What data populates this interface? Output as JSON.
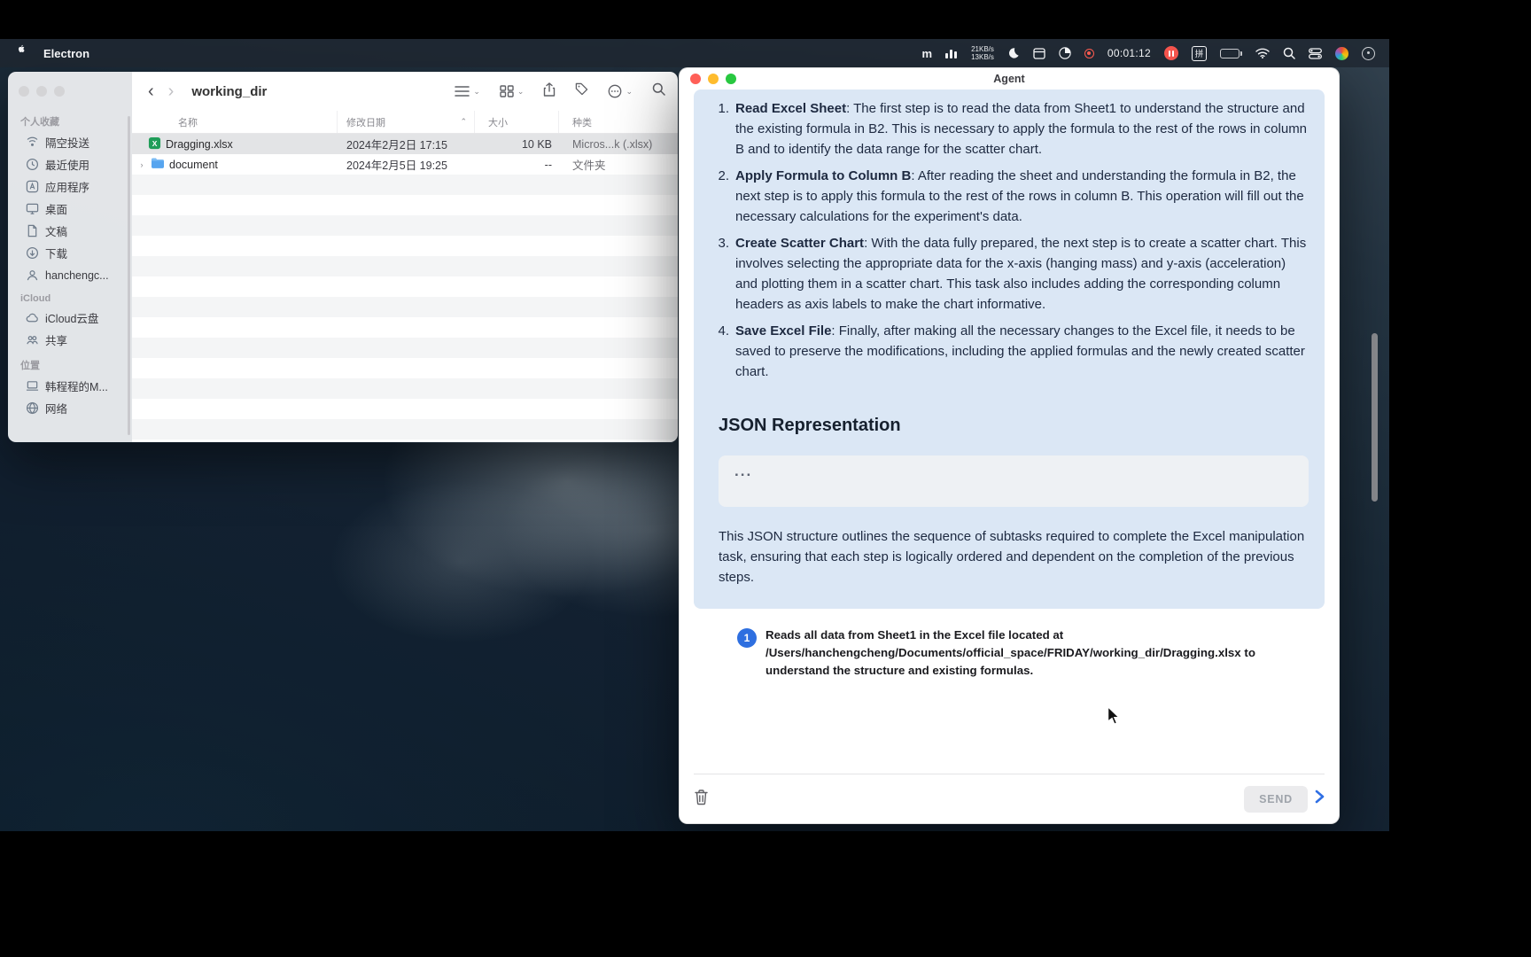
{
  "menu_bar": {
    "app_name": "Electron",
    "net_up": "21KB/s",
    "net_down": "13KB/s",
    "timer": "00:01:12",
    "ime": "拼"
  },
  "finder": {
    "title": "working_dir",
    "sidebar": {
      "sections": [
        {
          "label": "个人收藏",
          "items": [
            {
              "label": "隔空投送"
            },
            {
              "label": "最近使用"
            },
            {
              "label": "应用程序"
            },
            {
              "label": "桌面"
            },
            {
              "label": "文稿"
            },
            {
              "label": "下载"
            },
            {
              "label": "hanchengc..."
            }
          ]
        },
        {
          "label": "iCloud",
          "items": [
            {
              "label": "iCloud云盘"
            },
            {
              "label": "共享"
            }
          ]
        },
        {
          "label": "位置",
          "items": [
            {
              "label": "韩程程的M..."
            },
            {
              "label": "网络"
            }
          ]
        }
      ]
    },
    "columns": [
      "名称",
      "修改日期",
      "大小",
      "种类"
    ],
    "files": [
      {
        "name": "Dragging.xlsx",
        "date": "2024年2月2日 17:15",
        "size": "10 KB",
        "kind": "Micros...k (.xlsx)"
      },
      {
        "name": "document",
        "date": "2024年2月5日 19:25",
        "size": "--",
        "kind": "文件夹"
      }
    ]
  },
  "agent": {
    "title": "Agent",
    "steps": [
      {
        "num": "1.",
        "title": "Read Excel Sheet",
        "text": ": The first step is to read the data from Sheet1 to understand the structure and the existing formula in B2. This is necessary to apply the formula to the rest of the rows in column B and to identify the data range for the scatter chart."
      },
      {
        "num": "2.",
        "title": "Apply Formula to Column B",
        "text": ": After reading the sheet and understanding the formula in B2, the next step is to apply this formula to the rest of the rows in column B. This operation will fill out the necessary calculations for the experiment's data."
      },
      {
        "num": "3.",
        "title": "Create Scatter Chart",
        "text": ": With the data fully prepared, the next step is to create a scatter chart. This involves selecting the appropriate data for the x-axis (hanging mass) and y-axis (acceleration) and plotting them in a scatter chart. This task also includes adding the corresponding column headers as axis labels to make the chart informative."
      },
      {
        "num": "4.",
        "title": "Save Excel File",
        "text": ": Finally, after making all the necessary changes to the Excel file, it needs to be saved to preserve the modifications, including the applied formulas and the newly created scatter chart."
      }
    ],
    "json_heading": "JSON Representation",
    "json_placeholder": "...",
    "summary": "This JSON structure outlines the sequence of subtasks required to complete the Excel manipulation task, ensuring that each step is logically ordered and dependent on the completion of the previous steps.",
    "subtask": {
      "number": "1",
      "text": "Reads all data from Sheet1 in the Excel file located at /Users/hanchengcheng/Documents/official_space/FRIDAY/working_dir/Dragging.xlsx to understand the structure and existing formulas."
    },
    "send_label": "SEND"
  },
  "colors": {
    "panel_blue": "#dbe7f5",
    "subtask_circle_blue": "#2e6fe0",
    "excel_green": "#1f9d58",
    "folder_blue": "#57a5ef",
    "record_red": "#ff5b50"
  }
}
